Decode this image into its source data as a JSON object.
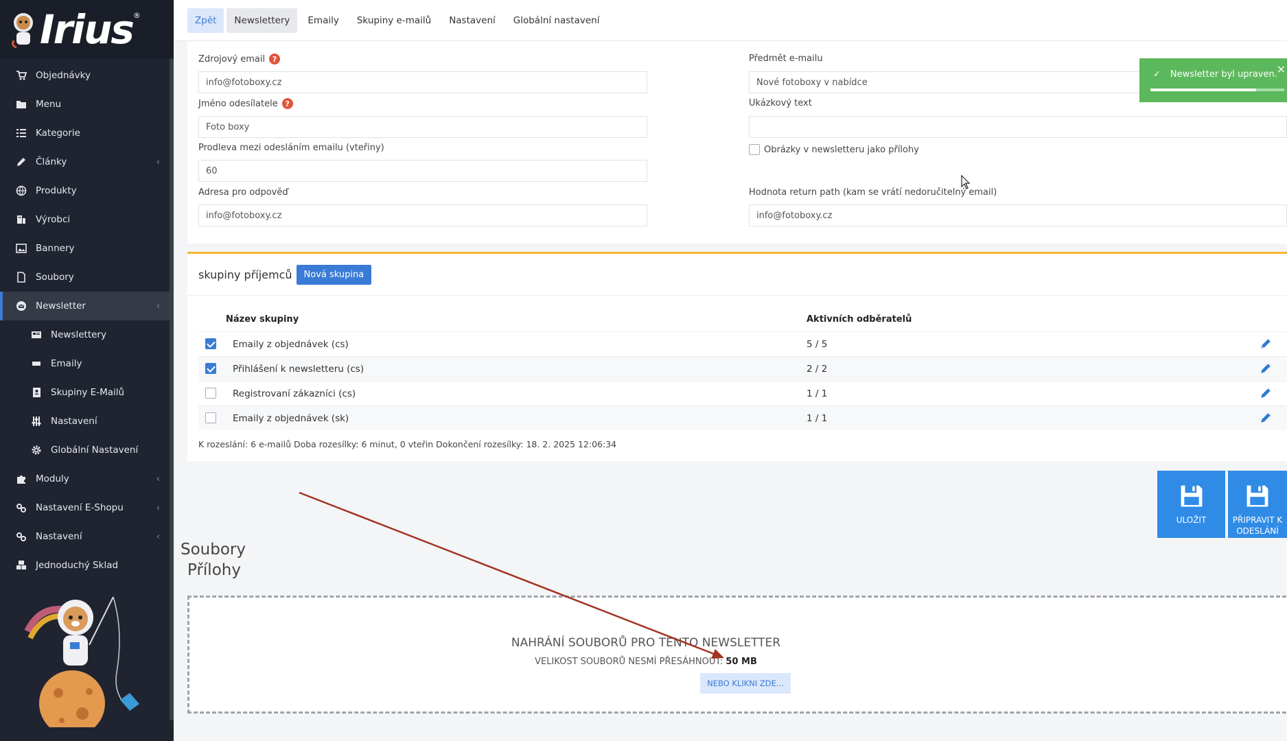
{
  "sidebar": {
    "logo_text": "Irius",
    "logo_mark": "®",
    "items": [
      {
        "label": "Objednávky",
        "icon": "cart-icon"
      },
      {
        "label": "Menu",
        "icon": "folder-icon"
      },
      {
        "label": "Kategorie",
        "icon": "list-icon"
      },
      {
        "label": "Články",
        "icon": "pencil-icon",
        "chevron": "‹"
      },
      {
        "label": "Produkty",
        "icon": "globe-icon"
      },
      {
        "label": "Výrobci",
        "icon": "building-icon"
      },
      {
        "label": "Bannery",
        "icon": "image-icon"
      },
      {
        "label": "Soubory",
        "icon": "file-icon"
      },
      {
        "label": "Newsletter",
        "icon": "envelope-icon",
        "chevron": "‹"
      },
      {
        "label": "Newslettery",
        "icon": "newspaper-icon"
      },
      {
        "label": "Emaily",
        "icon": "envelope-small-icon"
      },
      {
        "label": "Skupiny E-Mailů",
        "icon": "address-book-icon"
      },
      {
        "label": "Nastavení",
        "icon": "sliders-icon"
      },
      {
        "label": "Globální Nastavení",
        "icon": "gear-icon"
      },
      {
        "label": "Moduly",
        "icon": "puzzle-icon",
        "chevron": "‹"
      },
      {
        "label": "Nastavení E-Shopu",
        "icon": "cogs-icon",
        "chevron": "‹"
      },
      {
        "label": "Nastavení",
        "icon": "cogs-icon",
        "chevron": "‹"
      },
      {
        "label": "Jednoduchý Sklad",
        "icon": "boxes-icon"
      }
    ]
  },
  "tabs": [
    {
      "label": "Zpět"
    },
    {
      "label": "Newslettery"
    },
    {
      "label": "Emaily"
    },
    {
      "label": "Skupiny e-mailů"
    },
    {
      "label": "Nastavení"
    },
    {
      "label": "Globální nastavení"
    }
  ],
  "form": {
    "source_email": {
      "label": "Zdrojový email",
      "value": "info@fotoboxy.cz"
    },
    "sender_name": {
      "label": "Jméno odesílatele",
      "value": "Foto boxy"
    },
    "delay": {
      "label": "Prodleva mezi odesláním emailu (vteřiny)",
      "value": "60"
    },
    "reply_to": {
      "label": "Adresa pro odpověď",
      "value": "info@fotoboxy.cz"
    },
    "subject": {
      "label": "Předmět e-mailu",
      "value": "Nové fotoboxy v nabídce"
    },
    "preview_text": {
      "label": "Ukázkový text",
      "value": ""
    },
    "images_as_attachments": {
      "label": "Obrázky v newsletteru jako přílohy",
      "checked": false
    },
    "return_path": {
      "label": "Hodnota return path (kam se vrátí nedoručitelný email)",
      "value": "info@fotoboxy.cz"
    },
    "help_glyph": "?"
  },
  "toast": {
    "message": "Newsletter byl upraven.",
    "close": "×",
    "check": "✓",
    "progress": 0.79
  },
  "groups": {
    "title": "skupiny příjemců",
    "new_button": "Nová skupina",
    "col_name": "Název skupiny",
    "col_active": "Aktivních odběratelů",
    "rows": [
      {
        "name": "Emaily z objednávek (cs)",
        "count": "5 / 5",
        "checked": true
      },
      {
        "name": "Přihlášení k newsletteru (cs)",
        "count": "2 / 2",
        "checked": true
      },
      {
        "name": "Registrovaní zákazníci (cs)",
        "count": "1 / 1",
        "checked": false
      },
      {
        "name": "Emaily z objednávek (sk)",
        "count": "1 / 1",
        "checked": false
      }
    ],
    "summary": "K rozeslání: 6 e-mailů Doba rozesílky: 6 minut, 0 vteřin Dokončení rozesílky: 18. 2. 2025 12:06:34"
  },
  "actions": {
    "save": "ULOŽIT",
    "prepare_line1": "PŘIPRAVIT K",
    "prepare_line2": "ODESLÁNÍ"
  },
  "files": {
    "title": "Soubory",
    "subtitle": "Přílohy",
    "dz_title": "NAHRÁNÍ SOUBORŮ PRO TENTO NEWSLETTER",
    "dz_size_prefix": "VELIKOST SOUBORŮ NESMÍ PŘESÁHNOUT:",
    "dz_size_value": "50 MB",
    "dz_button": "NEBO KLIKNI ZDE..."
  },
  "colors": {
    "sidebar_bg": "#1f2430",
    "primary": "#3a7bd5",
    "toast": "#5cb85c",
    "accent_border": "#f5b731",
    "annotation_arrow": "#a33322"
  }
}
